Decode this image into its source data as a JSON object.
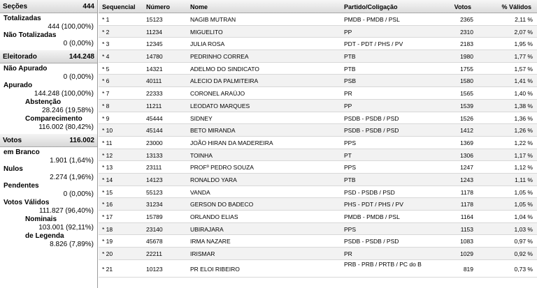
{
  "left": {
    "secoes": {
      "label": "Seções",
      "value": "444"
    },
    "totalizadas": {
      "label": "Totalizadas",
      "value": "444 (100,00%)"
    },
    "nao_totalizadas": {
      "label": "Não Totalizadas",
      "value": "0 (0,00%)"
    },
    "eleitorado": {
      "label": "Eleitorado",
      "value": "144.248"
    },
    "nao_apurado": {
      "label": "Não Apurado",
      "value": "0 (0,00%)"
    },
    "apurado": {
      "label": "Apurado",
      "value": "144.248 (100,00%)"
    },
    "abstencao": {
      "label": "Abstenção",
      "value": "28.246 (19,58%)"
    },
    "comparecimento": {
      "label": "Comparecimento",
      "value": "116.002 (80,42%)"
    },
    "votos": {
      "label": "Votos",
      "value": "116.002"
    },
    "em_branco": {
      "label": "em Branco",
      "value": "1.901 (1,64%)"
    },
    "nulos": {
      "label": "Nulos",
      "value": "2.274 (1,96%)"
    },
    "pendentes": {
      "label": "Pendentes",
      "value": "0 (0,00%)"
    },
    "votos_validos": {
      "label": "Votos Válidos",
      "value": "111.827 (96,40%)"
    },
    "nominais": {
      "label": "Nominais",
      "value": "103.001 (92,11%)"
    },
    "de_legenda": {
      "label": "de Legenda",
      "value": "8.826 (7,89%)"
    }
  },
  "table": {
    "headers": {
      "seq": "Sequencial",
      "num": "Número",
      "nome": "Nome",
      "partido": "Partido/Coligação",
      "votos": "Votos",
      "perc": "% Válidos"
    },
    "rows": [
      {
        "seq": "* 1",
        "num": "15123",
        "nome": "NAGIB MUTRAN",
        "partido": "PMDB - PMDB / PSL",
        "votos": "2365",
        "perc": "2,11 %"
      },
      {
        "seq": "* 2",
        "num": "11234",
        "nome": "MIGUELITO",
        "partido": "PP",
        "votos": "2310",
        "perc": "2,07 %"
      },
      {
        "seq": "* 3",
        "num": "12345",
        "nome": "JULIA ROSA",
        "partido": "PDT - PDT / PHS / PV",
        "votos": "2183",
        "perc": "1,95 %"
      },
      {
        "seq": "* 4",
        "num": "14780",
        "nome": "PEDRINHO CORREA",
        "partido": "PTB",
        "votos": "1980",
        "perc": "1,77 %"
      },
      {
        "seq": "* 5",
        "num": "14321",
        "nome": "ADELMO DO SINDICATO",
        "partido": "PTB",
        "votos": "1755",
        "perc": "1,57 %"
      },
      {
        "seq": "* 6",
        "num": "40111",
        "nome": "ALECIO DA PALMITEIRA",
        "partido": "PSB",
        "votos": "1580",
        "perc": "1,41 %"
      },
      {
        "seq": "* 7",
        "num": "22333",
        "nome": "CORONEL ARAÚJO",
        "partido": "PR",
        "votos": "1565",
        "perc": "1,40 %"
      },
      {
        "seq": "* 8",
        "num": "11211",
        "nome": "LEODATO MARQUES",
        "partido": "PP",
        "votos": "1539",
        "perc": "1,38 %"
      },
      {
        "seq": "* 9",
        "num": "45444",
        "nome": "SIDNEY",
        "partido": "PSDB - PSDB / PSD",
        "votos": "1526",
        "perc": "1,36 %"
      },
      {
        "seq": "* 10",
        "num": "45144",
        "nome": "BETO MIRANDA",
        "partido": "PSDB - PSDB / PSD",
        "votos": "1412",
        "perc": "1,26 %"
      },
      {
        "seq": "* 11",
        "num": "23000",
        "nome": "JOÃO HIRAN DA MADEREIRA",
        "partido": "PPS",
        "votos": "1369",
        "perc": "1,22 %"
      },
      {
        "seq": "* 12",
        "num": "13133",
        "nome": "TOINHA",
        "partido": "PT",
        "votos": "1306",
        "perc": "1,17 %"
      },
      {
        "seq": "* 13",
        "num": "23111",
        "nome": "PROFº PEDRO SOUZA",
        "partido": "PPS",
        "votos": "1247",
        "perc": "1,12 %"
      },
      {
        "seq": "* 14",
        "num": "14123",
        "nome": "RONALDO YARA",
        "partido": "PTB",
        "votos": "1243",
        "perc": "1,11 %"
      },
      {
        "seq": "* 15",
        "num": "55123",
        "nome": "VANDA",
        "partido": "PSD - PSDB / PSD",
        "votos": "1178",
        "perc": "1,05 %"
      },
      {
        "seq": "* 16",
        "num": "31234",
        "nome": "GERSON DO BADECO",
        "partido": "PHS - PDT / PHS / PV",
        "votos": "1178",
        "perc": "1,05 %"
      },
      {
        "seq": "* 17",
        "num": "15789",
        "nome": "ORLANDO ELIAS",
        "partido": "PMDB - PMDB / PSL",
        "votos": "1164",
        "perc": "1,04 %"
      },
      {
        "seq": "* 18",
        "num": "23140",
        "nome": "UBIRAJARA",
        "partido": "PPS",
        "votos": "1153",
        "perc": "1,03 %"
      },
      {
        "seq": "* 19",
        "num": "45678",
        "nome": "IRMA NAZARE",
        "partido": "PSDB - PSDB / PSD",
        "votos": "1083",
        "perc": "0,97 %"
      },
      {
        "seq": "* 20",
        "num": "22211",
        "nome": "IRISMAR",
        "partido": "PR",
        "votos": "1029",
        "perc": "0,92 %"
      },
      {
        "seq": "* 21",
        "num": "10123",
        "nome": "PR ELOI RIBEIRO",
        "partido": "PRB - PRB / PRTB / PC do B",
        "votos": "819",
        "perc": "0,73 %"
      }
    ]
  }
}
